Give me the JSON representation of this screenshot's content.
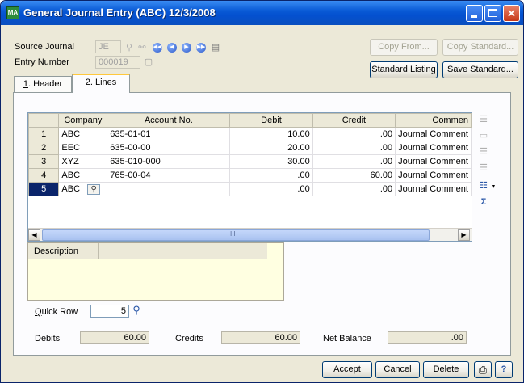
{
  "window": {
    "title": "General Journal Entry (ABC) 12/3/2008",
    "app_icon": "MA",
    "controls": [
      "minimize-icon",
      "maximize-icon",
      "close-icon"
    ]
  },
  "header_fields": {
    "source_journal_label": "Source Journal",
    "source_journal_value": "JE",
    "entry_number_label": "Entry Number",
    "entry_number_value": "000019"
  },
  "buttons": {
    "copy_from": "Copy From...",
    "copy_standard": "Copy Standard...",
    "standard_listing": "Standard Listing",
    "save_standard": "Save Standard...",
    "accept": "Accept",
    "cancel": "Cancel",
    "delete": "Delete"
  },
  "tabs": [
    {
      "num": "1",
      "label": ". Header"
    },
    {
      "num": "2",
      "label": ". Lines"
    }
  ],
  "grid": {
    "columns": [
      "",
      "Company",
      "Account No.",
      "Debit",
      "Credit",
      "Commen"
    ],
    "rows": [
      {
        "n": "1",
        "company": "ABC",
        "account": "635-01-01",
        "debit": "10.00",
        "credit": ".00",
        "comment": "Journal Comment"
      },
      {
        "n": "2",
        "company": "EEC",
        "account": "635-00-00",
        "debit": "20.00",
        "credit": ".00",
        "comment": "Journal Comment"
      },
      {
        "n": "3",
        "company": "XYZ",
        "account": "635-010-000",
        "debit": "30.00",
        "credit": ".00",
        "comment": "Journal Comment"
      },
      {
        "n": "4",
        "company": "ABC",
        "account": "765-00-04",
        "debit": ".00",
        "credit": "60.00",
        "comment": "Journal Comment"
      },
      {
        "n": "5",
        "company": "ABC",
        "account": "",
        "debit": ".00",
        "credit": ".00",
        "comment": "Journal Comment"
      }
    ],
    "scroll_grip": "III"
  },
  "description": {
    "header": "Description"
  },
  "quick_row": {
    "label_first": "Q",
    "label_rest": "uick Row",
    "value": "5"
  },
  "totals": {
    "debits_label": "Debits",
    "debits_value": "60.00",
    "credits_label": "Credits",
    "credits_value": "60.00",
    "net_label": "Net Balance",
    "net_value": ".00"
  },
  "colors": {
    "titlebar": "#0450d0",
    "selected_row": "#0a246a",
    "window_face": "#ece9d8"
  }
}
